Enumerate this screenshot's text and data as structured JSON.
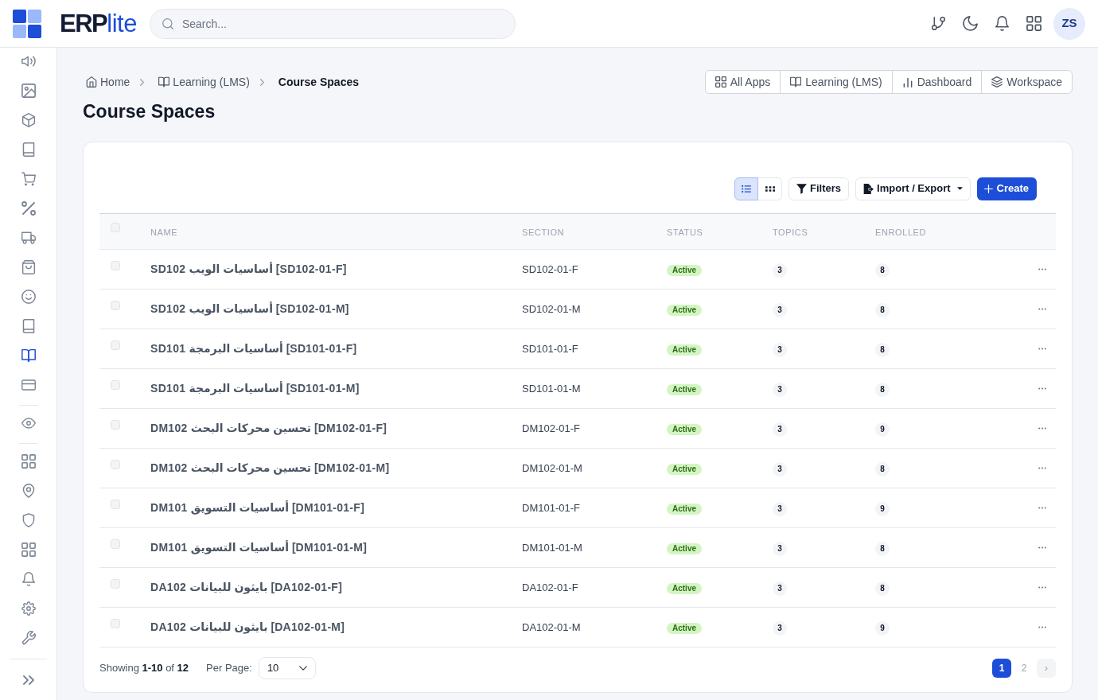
{
  "header": {
    "brand": "**ERP**lite",
    "search": {
      "placeholder": "Search..."
    },
    "avatar": "ZS"
  },
  "sidebar": {
    "sections": [
      {
        "items": [
          {
            "selected": false
          },
          {
            "selected": false
          },
          {
            "selected": false
          },
          {
            "selected": false
          },
          {
            "selected": false
          },
          {
            "selected": false
          },
          {
            "selected": false
          },
          {
            "selected": false
          },
          {
            "selected": false
          },
          {
            "selected": false
          },
          {
            "selected": true
          },
          {
            "selected": false
          }
        ]
      },
      {
        "items": [
          {
            "selected": false
          }
        ]
      },
      {
        "items": [
          {
            "selected": false
          },
          {
            "selected": false
          },
          {
            "selected": false
          },
          {
            "selected": false
          },
          {
            "selected": false
          },
          {
            "selected": false
          },
          {
            "selected": false
          }
        ]
      }
    ]
  },
  "breadcrumb": [
    {
      "label": "Home",
      "current": false
    },
    {
      "label": "Learning (LMS)",
      "current": false
    },
    {
      "label": "Course Spaces",
      "current": true
    }
  ],
  "page_title": "Course Spaces",
  "quick_links": [
    {
      "label": "All Apps"
    },
    {
      "label": "Learning (LMS)"
    },
    {
      "label": "Dashboard"
    },
    {
      "label": "Workspace"
    }
  ],
  "toolbar": {
    "view_modes": [
      {
        "kind": "list",
        "selected": true
      },
      {
        "kind": "grid",
        "selected": false
      }
    ],
    "filters": "Filters",
    "import_export": "Import / Export",
    "create": "Create"
  },
  "table": {
    "select_all_checked": false,
    "columns": [
      "NAME",
      "SECTION",
      "STATUS",
      "TOPICS",
      "ENROLLED"
    ],
    "rows": [
      {
        "checked": false,
        "name": "SD102 أساسيات الويب [SD102-01-F]",
        "section": "SD102-01-F",
        "status": "Active",
        "topics": "3",
        "enrolled": "8"
      },
      {
        "checked": false,
        "name": "SD102 أساسيات الويب [SD102-01-M]",
        "section": "SD102-01-M",
        "status": "Active",
        "topics": "3",
        "enrolled": "8"
      },
      {
        "checked": false,
        "name": "SD101 أساسيات البرمجة [SD101-01-F]",
        "section": "SD101-01-F",
        "status": "Active",
        "topics": "3",
        "enrolled": "8"
      },
      {
        "checked": false,
        "name": "SD101 أساسيات البرمجة [SD101-01-M]",
        "section": "SD101-01-M",
        "status": "Active",
        "topics": "3",
        "enrolled": "8"
      },
      {
        "checked": false,
        "name": "DM102 تحسين محركات البحث [DM102-01-F]",
        "section": "DM102-01-F",
        "status": "Active",
        "topics": "3",
        "enrolled": "9"
      },
      {
        "checked": false,
        "name": "DM102 تحسين محركات البحث [DM102-01-M]",
        "section": "DM102-01-M",
        "status": "Active",
        "topics": "3",
        "enrolled": "8"
      },
      {
        "checked": false,
        "name": "DM101 أساسيات التسويق [DM101-01-F]",
        "section": "DM101-01-F",
        "status": "Active",
        "topics": "3",
        "enrolled": "9"
      },
      {
        "checked": false,
        "name": "DM101 أساسيات التسويق [DM101-01-M]",
        "section": "DM101-01-M",
        "status": "Active",
        "topics": "3",
        "enrolled": "8"
      },
      {
        "checked": false,
        "name": "DA102 بايثون للبيانات [DA102-01-F]",
        "section": "DA102-01-F",
        "status": "Active",
        "topics": "3",
        "enrolled": "8"
      },
      {
        "checked": false,
        "name": "DA102 بايثون للبيانات [DA102-01-M]",
        "section": "DA102-01-M",
        "status": "Active",
        "topics": "3",
        "enrolled": "9"
      }
    ]
  },
  "footer": {
    "summary": "Showing **1-10** of **12**",
    "per_page_label": "Per Page:",
    "per_page": "10",
    "pages": [
      {
        "label": "1",
        "selected": true
      },
      {
        "label": "2",
        "selected": false
      }
    ],
    "next": "›"
  }
}
